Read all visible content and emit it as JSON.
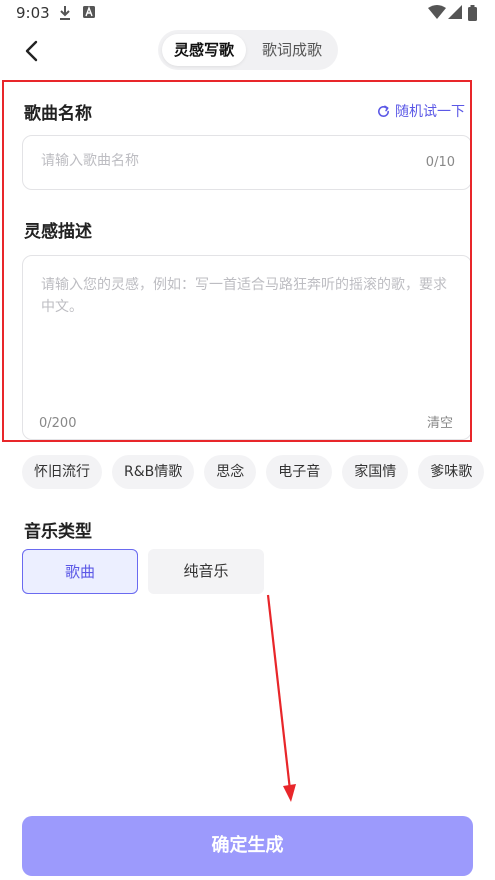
{
  "status_bar": {
    "time": "9:03"
  },
  "header": {
    "tabs": [
      {
        "label": "灵感写歌",
        "active": true
      },
      {
        "label": "歌词成歌",
        "active": false
      }
    ]
  },
  "song_name": {
    "title": "歌曲名称",
    "random_label": "随机试一下",
    "placeholder": "请输入歌曲名称",
    "value": "",
    "counter": "0/10"
  },
  "inspiration": {
    "title": "灵感描述",
    "placeholder": "请输入您的灵感，例如：写一首适合马路狂奔听的摇滚的歌，要求中文。",
    "value": "",
    "counter": "0/200",
    "clear_label": "清空"
  },
  "tags": [
    "怀旧流行",
    "R&B情歌",
    "思念",
    "电子音",
    "家国情",
    "爹味歌"
  ],
  "music_type": {
    "title": "音乐类型",
    "options": [
      {
        "label": "歌曲",
        "selected": true
      },
      {
        "label": "纯音乐",
        "selected": false
      }
    ]
  },
  "submit_label": "确定生成",
  "colors": {
    "accent": "#5b58e6",
    "button": "#9c9afc",
    "highlight": "#e8262a"
  }
}
